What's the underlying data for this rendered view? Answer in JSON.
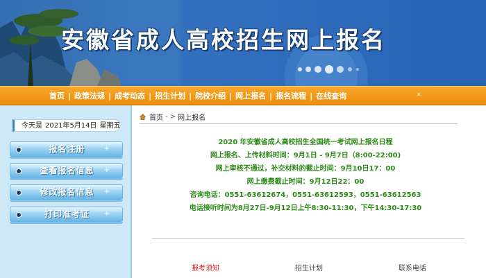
{
  "banner": {
    "title": "安徽省成人高校招生网上报名"
  },
  "nav": {
    "items": [
      "首页",
      "政策法规",
      "成考动态",
      "招生计划",
      "院校介绍",
      "网上报名",
      "报名流程",
      "在线查询"
    ],
    "separator": "|"
  },
  "sidebar": {
    "date": {
      "prefix": "今天是",
      "date": "2021年5月14日",
      "weekday": "星期五"
    },
    "buttons": [
      {
        "label": "报名注册",
        "plus": "+"
      },
      {
        "label": "查看报名信息",
        "plus": "+"
      },
      {
        "label": "修改报名信息",
        "plus": "+"
      },
      {
        "label": "打印准考证",
        "plus": "+"
      }
    ]
  },
  "breadcrumb": {
    "home": "首页",
    "separator": "- >",
    "current": "网上报名"
  },
  "notice": {
    "lines": [
      "2020 年安徽省成人高校招生全国统一考试网上报名日程",
      "网上报名、上传材料时间：9月1日 - 9月7日（8:00-22:00)",
      "网上审核不通过，补交材料的截止时间：9月10日17：00",
      "网上缴费截止时间：9月12日22：00",
      "咨询电话：0551-63612674，0551-63612593，0551-63612563",
      "电话接听时间为8月27日-9月12日上午8:30-11:30，下午14:30-17:30"
    ],
    "color": "#2e8b19"
  },
  "tabs": [
    {
      "label": "报考须知",
      "active": true
    },
    {
      "label": "招生计划",
      "active": false
    },
    {
      "label": "联系电话",
      "active": false
    }
  ],
  "colors": {
    "nav": "#f29a1c",
    "sidebar": "#cfe8f7",
    "active_tab": "#e21c1c",
    "banner": "#2f6cbb"
  }
}
